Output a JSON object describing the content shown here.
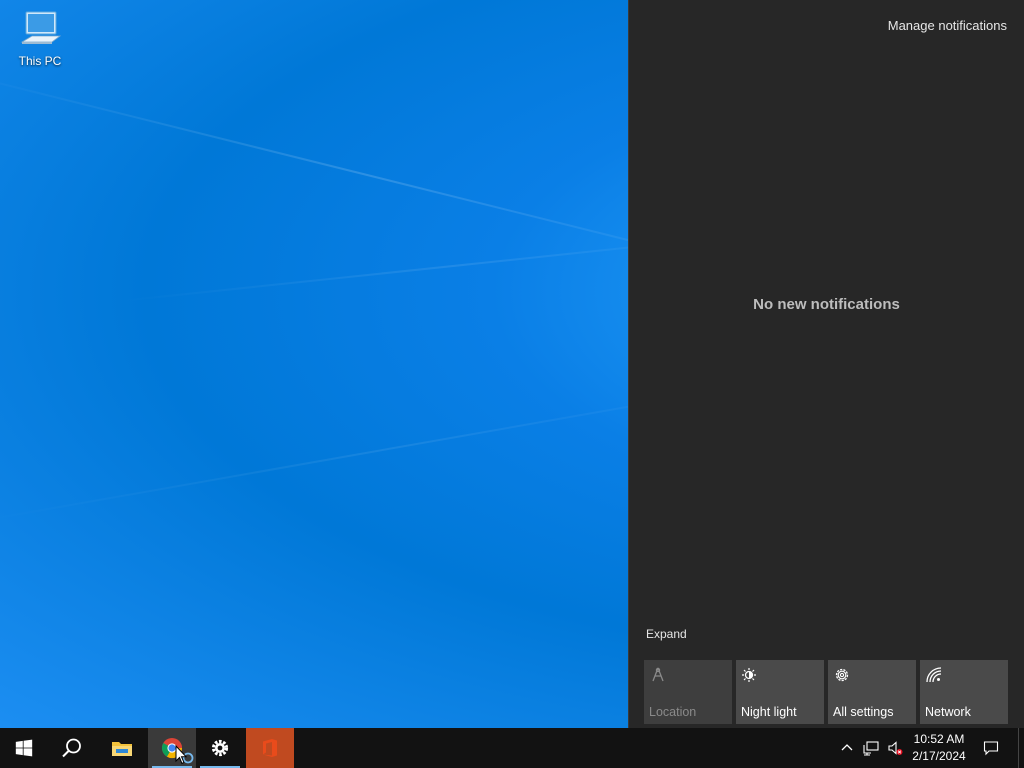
{
  "desktop": {
    "icons": [
      {
        "label": "This PC",
        "icon": "this-pc-icon"
      }
    ]
  },
  "action_center": {
    "manage_label": "Manage notifications",
    "empty_message": "No new notifications",
    "expand_label": "Expand",
    "quick_actions": [
      {
        "label": "Location",
        "icon": "location-icon",
        "enabled": false
      },
      {
        "label": "Night light",
        "icon": "night-light-icon",
        "enabled": true
      },
      {
        "label": "All settings",
        "icon": "gear-icon",
        "enabled": true
      },
      {
        "label": "Network",
        "icon": "network-icon",
        "enabled": true
      }
    ]
  },
  "taskbar": {
    "apps": [
      {
        "name": "start",
        "icon": "windows-logo-icon"
      },
      {
        "name": "search",
        "icon": "search-icon"
      },
      {
        "name": "file-explorer",
        "icon": "folder-icon",
        "running": false
      },
      {
        "name": "chrome",
        "icon": "chrome-icon",
        "running": true
      },
      {
        "name": "settings",
        "icon": "gear-icon",
        "running": true
      },
      {
        "name": "office",
        "icon": "office-icon",
        "running": false
      }
    ],
    "tray": {
      "time": "10:52 AM",
      "date": "2/17/2024"
    }
  },
  "colors": {
    "desktop_blue": "#0078d7",
    "action_center_bg": "#272727",
    "taskbar_bg": "#121212",
    "tile_bg": "#4a4a4a",
    "running_indicator": "#76b9ed",
    "office_accent": "#c04a20"
  }
}
